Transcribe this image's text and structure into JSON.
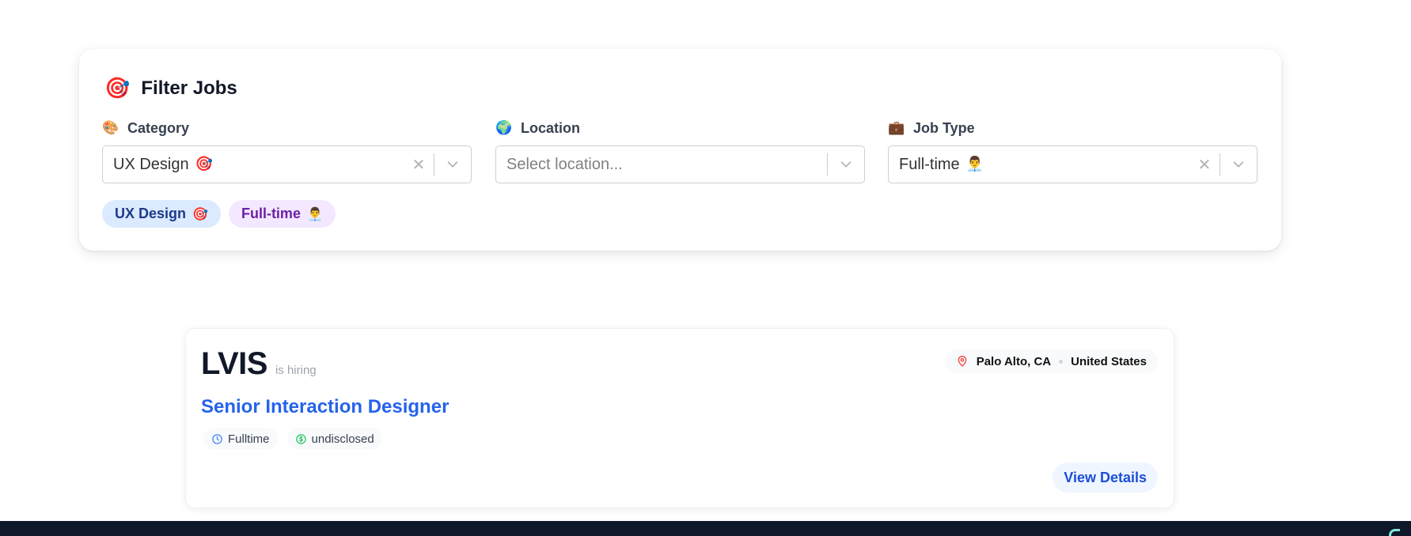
{
  "filter": {
    "title": "Filter Jobs",
    "title_icon": "🎯",
    "category": {
      "label": "Category",
      "icon": "🎨",
      "value": "UX Design",
      "value_icon": "🎯"
    },
    "location": {
      "label": "Location",
      "icon": "🌍",
      "placeholder": "Select location..."
    },
    "job_type": {
      "label": "Job Type",
      "icon": "💼",
      "value": "Full-time",
      "value_icon": "👨‍💼"
    },
    "active_chips": [
      {
        "label": "UX Design",
        "icon": "🎯",
        "color": "#dbeafe"
      },
      {
        "label": "Full-time",
        "icon": "👨‍💼",
        "color": "#f3e8ff"
      }
    ],
    "clear_glyph": "✕"
  },
  "job": {
    "company": "LVIS",
    "hiring_text": "is hiring",
    "city": "Palo Alto, CA",
    "country": "United States",
    "title": "Senior Interaction Designer",
    "employment": "Fulltime",
    "salary": "undisclosed",
    "view_button": "View Details"
  },
  "colors": {
    "accent_blue": "#2563eb",
    "footer": "#0f172a"
  }
}
